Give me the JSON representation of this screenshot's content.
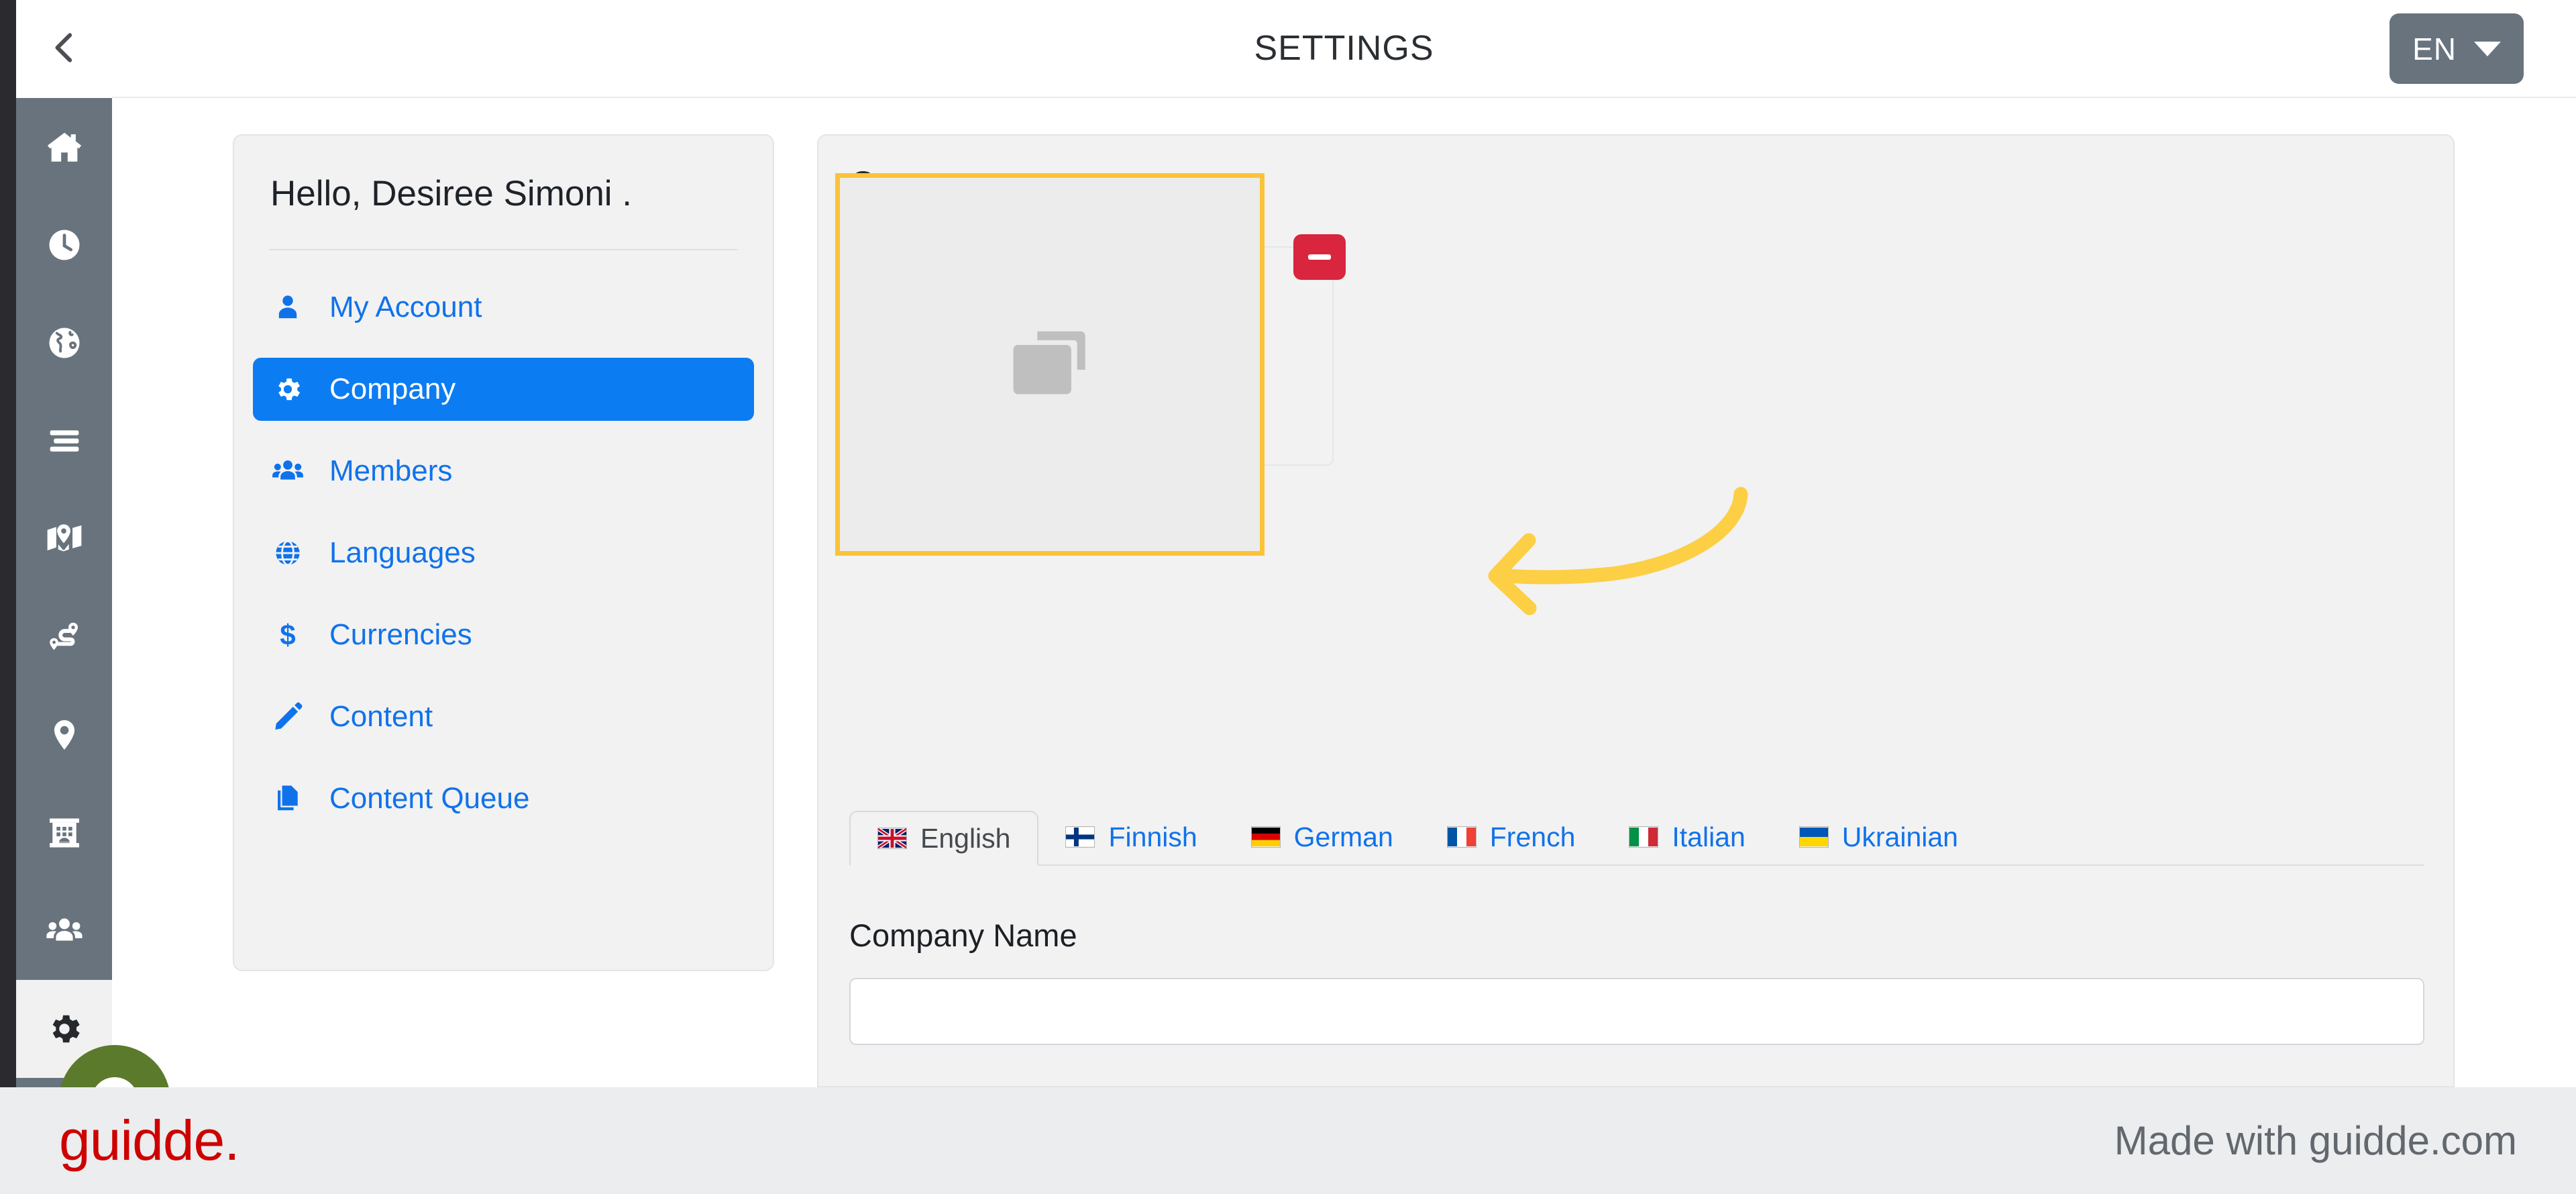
{
  "header": {
    "title": "SETTINGS",
    "back_icon": "chevron-left-icon",
    "language_selector": {
      "label": "EN",
      "caret_icon": "chevron-down-icon"
    }
  },
  "rail": {
    "background": "#68737d",
    "active_background": "#f1f1f1",
    "items": [
      {
        "icon": "home-icon",
        "active": false
      },
      {
        "icon": "clock-icon",
        "active": false
      },
      {
        "icon": "globe-icon",
        "active": false
      },
      {
        "icon": "list-icon",
        "active": false
      },
      {
        "icon": "map-icon",
        "active": false
      },
      {
        "icon": "route-icon",
        "active": false
      },
      {
        "icon": "location-pin-icon",
        "active": false
      },
      {
        "icon": "building-icon",
        "active": false
      },
      {
        "icon": "people-icon",
        "active": false
      },
      {
        "icon": "gear-icon",
        "active": true
      }
    ]
  },
  "menu_card": {
    "greeting": "Hello, Desiree Simoni .",
    "items": [
      {
        "label": "My Account",
        "icon": "user-icon",
        "active": false
      },
      {
        "label": "Company",
        "icon": "gear-icon",
        "active": true
      },
      {
        "label": "Members",
        "icon": "people-icon",
        "active": false
      },
      {
        "label": "Languages",
        "icon": "globe-icon",
        "active": false
      },
      {
        "label": "Currencies",
        "icon": "dollar-icon",
        "active": false
      },
      {
        "label": "Content",
        "icon": "pencil-icon",
        "active": false
      },
      {
        "label": "Content Queue",
        "icon": "copy-document-icon",
        "active": false
      }
    ],
    "accent_color": "#0c7cf2",
    "link_color": "#1072eb"
  },
  "main_panel": {
    "title": "Company",
    "upload": {
      "remove_button_label": "",
      "remove_icon": "minus-icon",
      "remove_color": "#d9253e",
      "placeholder_icon": "images-icon",
      "highlight_color": "#fbc338"
    },
    "language_tabs": [
      {
        "label": "English",
        "flag": "flag-gb",
        "active": true
      },
      {
        "label": "Finnish",
        "flag": "flag-fi",
        "active": false
      },
      {
        "label": "German",
        "flag": "flag-de",
        "active": false
      },
      {
        "label": "French",
        "flag": "flag-fr",
        "active": false
      },
      {
        "label": "Italian",
        "flag": "flag-it",
        "active": false
      },
      {
        "label": "Ukrainian",
        "flag": "flag-ua",
        "active": false
      }
    ],
    "company_name": {
      "label": "Company Name",
      "value": "",
      "placeholder": ""
    }
  },
  "annotation": {
    "arrow_icon": "curved-arrow-left-icon",
    "color": "#fbc338"
  },
  "footer": {
    "brand": "guidde.",
    "brand_color": "#ce0000",
    "made_with": "Made with guidde.com"
  }
}
